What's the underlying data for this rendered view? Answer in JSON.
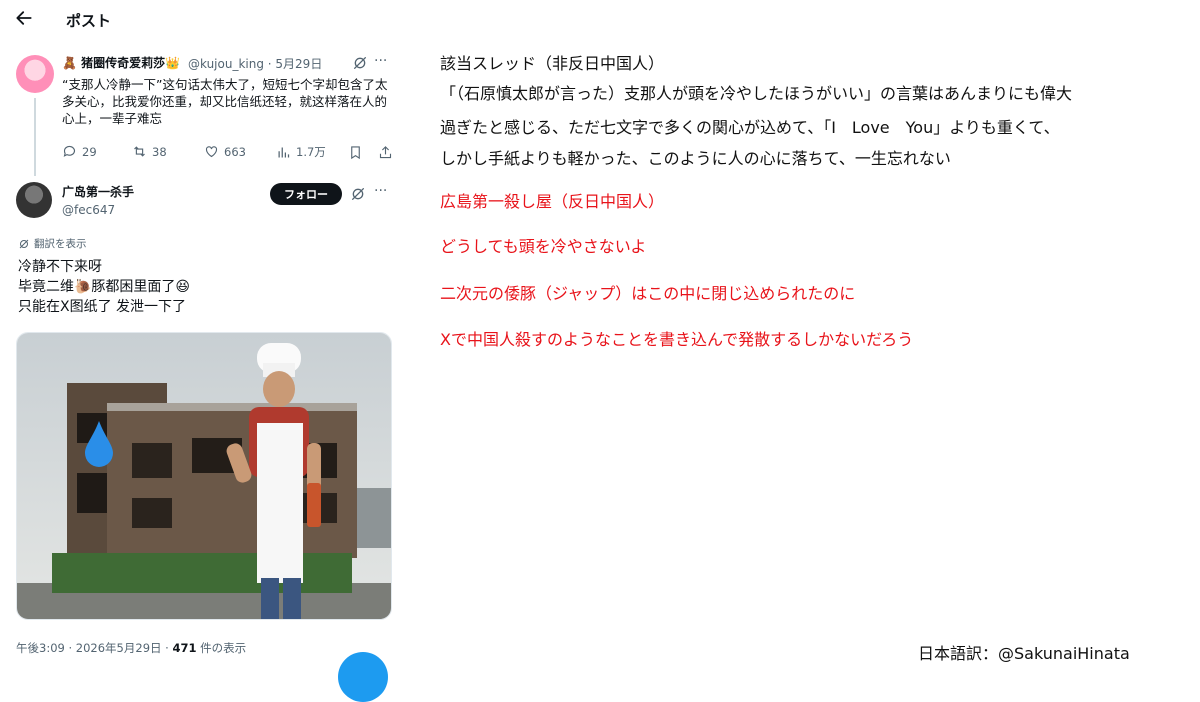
{
  "header": {
    "title": "ポスト"
  },
  "quoted_post": {
    "display_name": "🧸 猪圈传奇爱莉莎👑",
    "handle_date": "@kujou_king · 5月29日",
    "text": "“支那人冷静一下”这句话太伟大了，短短七个字却包含了太多关心，比我爱你还重，却又比信纸还轻，就这样落在人的心上，一辈子难忘",
    "replies": "29",
    "reposts": "38",
    "likes": "663",
    "views": "1.7万"
  },
  "main_post": {
    "display_name": "广岛第一杀手",
    "handle": "@fec647",
    "follow_label": "フォロー",
    "translate_label": "翻訳を表示",
    "lines": [
      "冷静不下来呀",
      "毕竟二维🐌豚都困里面了😆",
      "只能在X图纸了 发泄一下了"
    ],
    "timestamp": "午後3:09 · 2026年5月29日 · ",
    "views_count": "471",
    "views_suffix": " 件の表示"
  },
  "translation": {
    "line1": "該当スレッド（非反日中国人）",
    "line2": "「（石原慎太郎が言った）支那人が頭を冷やしたほうがいい」の言葉はあんまりにも偉大",
    "line3": "過ぎたと感じる、ただ七文字で多くの関心が込めて、「I　Love　You」よりも重くて、",
    "line4": "しかし手紙よりも軽かった、このように人の心に落ちて、一生忘れない",
    "red1": "広島第一殺し屋（反日中国人）",
    "red2": "どうしても頭を冷やさないよ",
    "red3": "二次元の倭豚（ジャップ）はこの中に閉じ込められたのに",
    "red4": "Xで中国人殺すのようなことを書き込んで発散するしかないだろう",
    "credit": "日本語訳：@SakunaiHinata"
  },
  "colors": {
    "accent": "#1d9bf0",
    "red_text": "#e8131a"
  }
}
